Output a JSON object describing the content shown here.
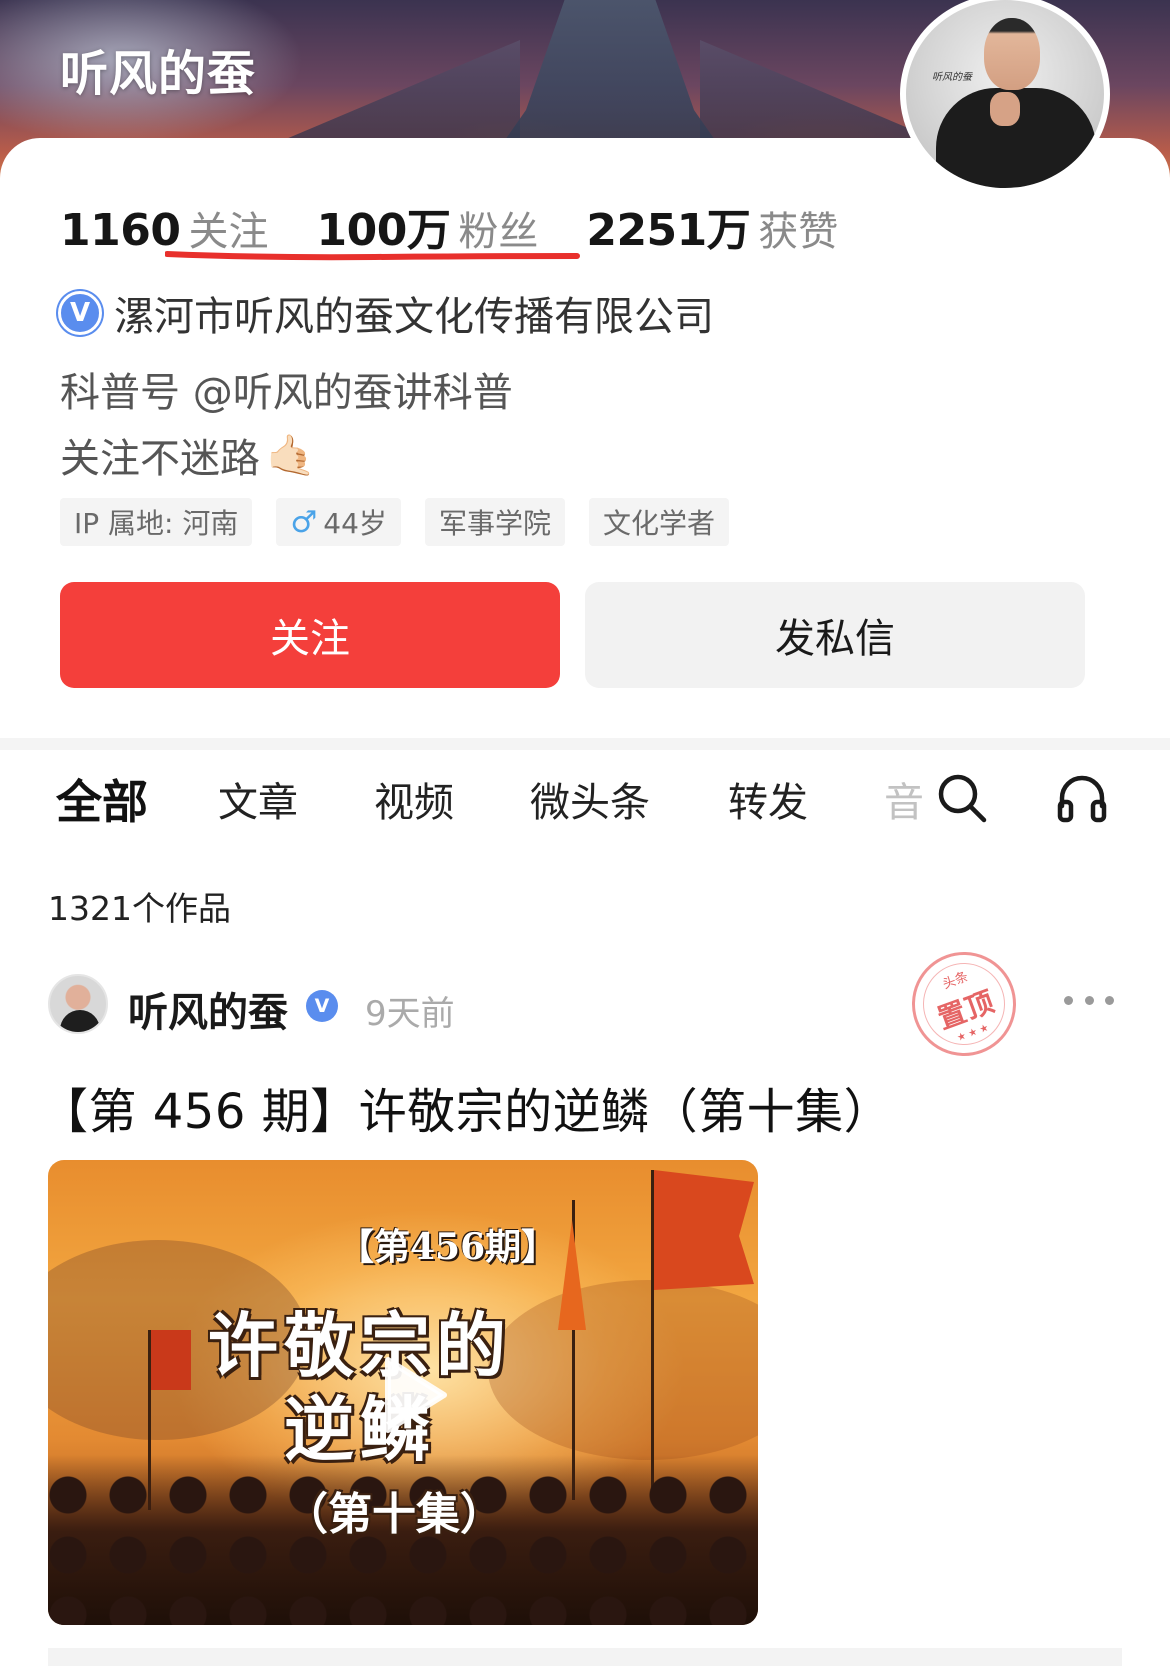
{
  "header": {
    "title": "听风的蚕"
  },
  "profile": {
    "avatar_signature": "听风的蚕",
    "stats": [
      {
        "value": "1160",
        "label": "关注"
      },
      {
        "value": "100万",
        "label": "粉丝"
      },
      {
        "value": "2251万",
        "label": "获赞"
      }
    ],
    "verified_badge": "V",
    "company": "漯河市听风的蚕文化传播有限公司",
    "bio_line1": "科普号 @听风的蚕讲科普",
    "bio_line2": "关注不迷路",
    "bio_emoji": "🤙🏻",
    "tags": [
      {
        "text": "IP 属地: 河南"
      },
      {
        "icon": "♂",
        "text": "44岁"
      },
      {
        "text": "军事学院"
      },
      {
        "text": "文化学者"
      }
    ],
    "follow_button": "关注",
    "message_button": "发私信"
  },
  "tabs": {
    "items": [
      "全部",
      "文章",
      "视频",
      "微头条",
      "转发",
      "音"
    ],
    "active_index": 0
  },
  "works_count": "1321个作品",
  "post": {
    "author": "听风的蚕",
    "verified_badge": "V",
    "time": "9天前",
    "pin_stamp_small": "头条",
    "pin_stamp_big": "置顶",
    "pin_stamp_stars": "★★★",
    "title": "【第 456 期】许敬宗的逆鳞（第十集）",
    "thumbnail": {
      "episode": "【第456期】",
      "line1": "许敬宗的",
      "line2": "逆鳞",
      "line3": "（第十集）"
    }
  },
  "colors": {
    "follow_red": "#f43f3b",
    "underline_red": "#e8302c",
    "verified_blue": "#5a8dee",
    "gender_blue": "#4aa3e8",
    "pin_red": "#e04a4a"
  }
}
